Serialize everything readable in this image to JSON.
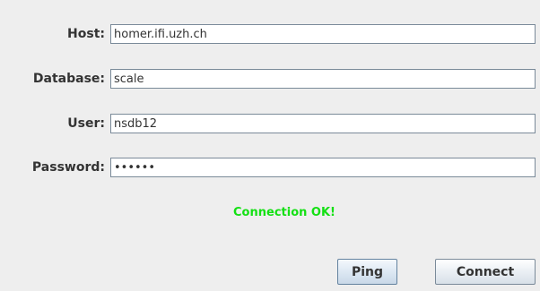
{
  "form": {
    "host": {
      "label": "Host:",
      "value": "homer.ifi.uzh.ch"
    },
    "database": {
      "label": "Database:",
      "value": "scale"
    },
    "user": {
      "label": "User:",
      "value": "nsdb12"
    },
    "password": {
      "label": "Password:",
      "value": "••••••"
    }
  },
  "status": {
    "message": "Connection OK!",
    "color": "#14e014"
  },
  "actions": {
    "ping_label": "Ping",
    "connect_label": "Connect"
  }
}
